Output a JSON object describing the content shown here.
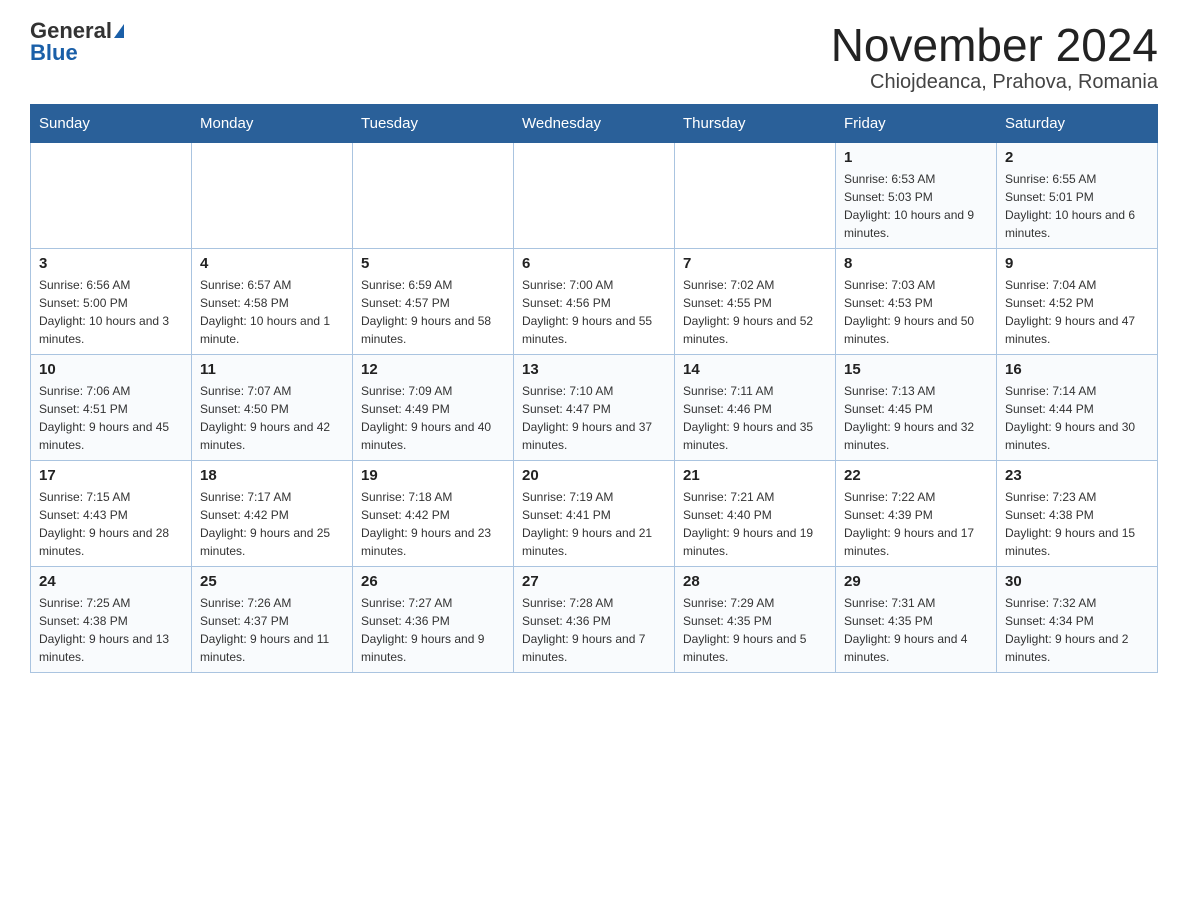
{
  "logo": {
    "general": "General",
    "blue": "Blue"
  },
  "title": "November 2024",
  "subtitle": "Chiojdeanca, Prahova, Romania",
  "days_of_week": [
    "Sunday",
    "Monday",
    "Tuesday",
    "Wednesday",
    "Thursday",
    "Friday",
    "Saturday"
  ],
  "weeks": [
    [
      {
        "day": "",
        "info": ""
      },
      {
        "day": "",
        "info": ""
      },
      {
        "day": "",
        "info": ""
      },
      {
        "day": "",
        "info": ""
      },
      {
        "day": "",
        "info": ""
      },
      {
        "day": "1",
        "info": "Sunrise: 6:53 AM\nSunset: 5:03 PM\nDaylight: 10 hours and 9 minutes."
      },
      {
        "day": "2",
        "info": "Sunrise: 6:55 AM\nSunset: 5:01 PM\nDaylight: 10 hours and 6 minutes."
      }
    ],
    [
      {
        "day": "3",
        "info": "Sunrise: 6:56 AM\nSunset: 5:00 PM\nDaylight: 10 hours and 3 minutes."
      },
      {
        "day": "4",
        "info": "Sunrise: 6:57 AM\nSunset: 4:58 PM\nDaylight: 10 hours and 1 minute."
      },
      {
        "day": "5",
        "info": "Sunrise: 6:59 AM\nSunset: 4:57 PM\nDaylight: 9 hours and 58 minutes."
      },
      {
        "day": "6",
        "info": "Sunrise: 7:00 AM\nSunset: 4:56 PM\nDaylight: 9 hours and 55 minutes."
      },
      {
        "day": "7",
        "info": "Sunrise: 7:02 AM\nSunset: 4:55 PM\nDaylight: 9 hours and 52 minutes."
      },
      {
        "day": "8",
        "info": "Sunrise: 7:03 AM\nSunset: 4:53 PM\nDaylight: 9 hours and 50 minutes."
      },
      {
        "day": "9",
        "info": "Sunrise: 7:04 AM\nSunset: 4:52 PM\nDaylight: 9 hours and 47 minutes."
      }
    ],
    [
      {
        "day": "10",
        "info": "Sunrise: 7:06 AM\nSunset: 4:51 PM\nDaylight: 9 hours and 45 minutes."
      },
      {
        "day": "11",
        "info": "Sunrise: 7:07 AM\nSunset: 4:50 PM\nDaylight: 9 hours and 42 minutes."
      },
      {
        "day": "12",
        "info": "Sunrise: 7:09 AM\nSunset: 4:49 PM\nDaylight: 9 hours and 40 minutes."
      },
      {
        "day": "13",
        "info": "Sunrise: 7:10 AM\nSunset: 4:47 PM\nDaylight: 9 hours and 37 minutes."
      },
      {
        "day": "14",
        "info": "Sunrise: 7:11 AM\nSunset: 4:46 PM\nDaylight: 9 hours and 35 minutes."
      },
      {
        "day": "15",
        "info": "Sunrise: 7:13 AM\nSunset: 4:45 PM\nDaylight: 9 hours and 32 minutes."
      },
      {
        "day": "16",
        "info": "Sunrise: 7:14 AM\nSunset: 4:44 PM\nDaylight: 9 hours and 30 minutes."
      }
    ],
    [
      {
        "day": "17",
        "info": "Sunrise: 7:15 AM\nSunset: 4:43 PM\nDaylight: 9 hours and 28 minutes."
      },
      {
        "day": "18",
        "info": "Sunrise: 7:17 AM\nSunset: 4:42 PM\nDaylight: 9 hours and 25 minutes."
      },
      {
        "day": "19",
        "info": "Sunrise: 7:18 AM\nSunset: 4:42 PM\nDaylight: 9 hours and 23 minutes."
      },
      {
        "day": "20",
        "info": "Sunrise: 7:19 AM\nSunset: 4:41 PM\nDaylight: 9 hours and 21 minutes."
      },
      {
        "day": "21",
        "info": "Sunrise: 7:21 AM\nSunset: 4:40 PM\nDaylight: 9 hours and 19 minutes."
      },
      {
        "day": "22",
        "info": "Sunrise: 7:22 AM\nSunset: 4:39 PM\nDaylight: 9 hours and 17 minutes."
      },
      {
        "day": "23",
        "info": "Sunrise: 7:23 AM\nSunset: 4:38 PM\nDaylight: 9 hours and 15 minutes."
      }
    ],
    [
      {
        "day": "24",
        "info": "Sunrise: 7:25 AM\nSunset: 4:38 PM\nDaylight: 9 hours and 13 minutes."
      },
      {
        "day": "25",
        "info": "Sunrise: 7:26 AM\nSunset: 4:37 PM\nDaylight: 9 hours and 11 minutes."
      },
      {
        "day": "26",
        "info": "Sunrise: 7:27 AM\nSunset: 4:36 PM\nDaylight: 9 hours and 9 minutes."
      },
      {
        "day": "27",
        "info": "Sunrise: 7:28 AM\nSunset: 4:36 PM\nDaylight: 9 hours and 7 minutes."
      },
      {
        "day": "28",
        "info": "Sunrise: 7:29 AM\nSunset: 4:35 PM\nDaylight: 9 hours and 5 minutes."
      },
      {
        "day": "29",
        "info": "Sunrise: 7:31 AM\nSunset: 4:35 PM\nDaylight: 9 hours and 4 minutes."
      },
      {
        "day": "30",
        "info": "Sunrise: 7:32 AM\nSunset: 4:34 PM\nDaylight: 9 hours and 2 minutes."
      }
    ]
  ]
}
